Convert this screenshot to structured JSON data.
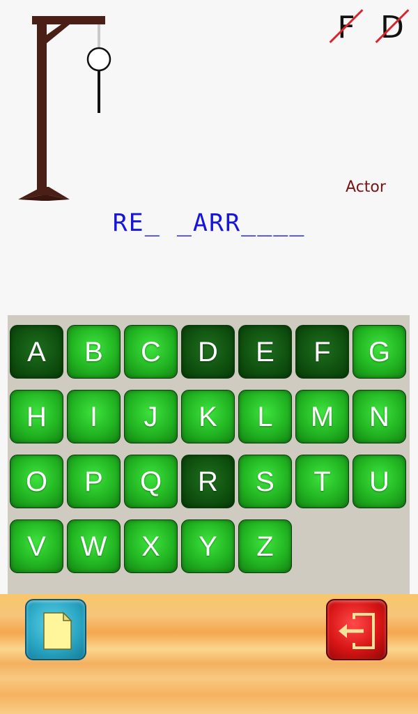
{
  "wrong_guesses": [
    "F",
    "D"
  ],
  "category": "Actor",
  "word_display": "RE_ _ARR____",
  "keyboard": {
    "rows": [
      [
        "A",
        "B",
        "C",
        "D",
        "E",
        "F",
        "G"
      ],
      [
        "H",
        "I",
        "J",
        "K",
        "L",
        "M",
        "N"
      ],
      [
        "O",
        "P",
        "Q",
        "R",
        "S",
        "T",
        "U"
      ],
      [
        "V",
        "W",
        "X",
        "Y",
        "Z"
      ]
    ],
    "used": [
      "A",
      "D",
      "E",
      "F",
      "R"
    ]
  },
  "buttons": {
    "new_game_icon": "document-icon",
    "exit_icon": "exit-icon"
  },
  "colors": {
    "word": "#1616d9",
    "category": "#7a1414",
    "strike": "#d9262c",
    "key": "#22b522",
    "key_used": "#0f500f"
  }
}
